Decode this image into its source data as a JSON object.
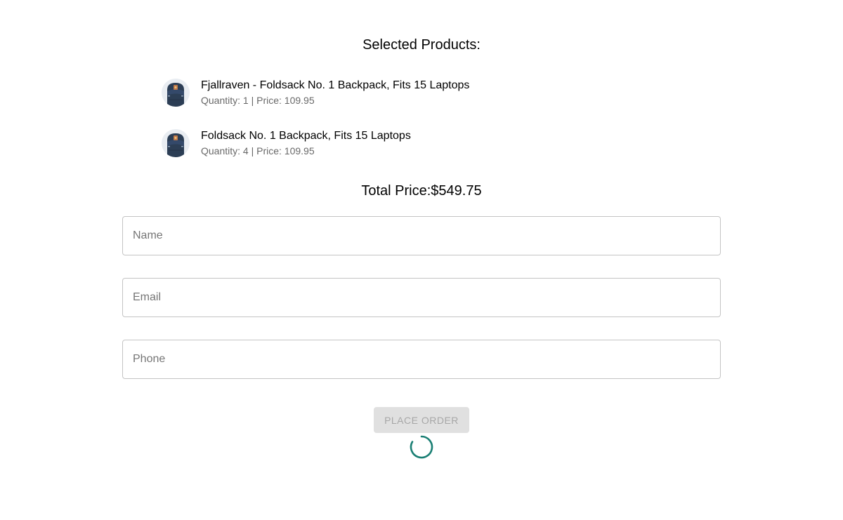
{
  "heading": "Selected Products:",
  "products": [
    {
      "name": "Fjallraven - Foldsack No. 1 Backpack, Fits 15 Laptops",
      "meta": "Quantity: 1 | Price: 109.95",
      "icon": "backpack-thumbnail"
    },
    {
      "name": "Foldsack No. 1 Backpack, Fits 15 Laptops",
      "meta": "Quantity: 4 | Price: 109.95",
      "icon": "backpack-thumbnail"
    }
  ],
  "total": "Total Price:$549.75",
  "form": {
    "name_placeholder": "Name",
    "email_placeholder": "Email",
    "phone_placeholder": "Phone",
    "submit_label": "PLACE ORDER"
  },
  "loading": true,
  "colors": {
    "spinner": "#1a7f74",
    "button_disabled_bg": "#e0e0e0",
    "backpack": "#2c3e55"
  }
}
